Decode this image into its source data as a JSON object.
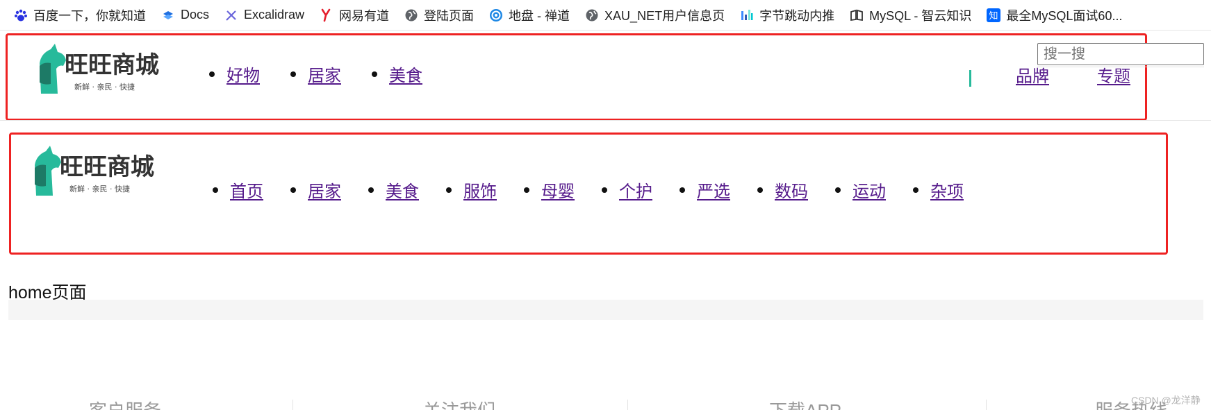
{
  "bookmarks": [
    {
      "label": "百度一下，你就知道",
      "icon": "baidu-paw-icon"
    },
    {
      "label": "Docs",
      "icon": "docs-icon"
    },
    {
      "label": "Excalidraw",
      "icon": "excalidraw-icon"
    },
    {
      "label": "网易有道",
      "icon": "youdao-icon"
    },
    {
      "label": "登陆页面",
      "icon": "globe-icon"
    },
    {
      "label": "地盘 - 禅道",
      "icon": "zentao-icon"
    },
    {
      "label": "XAU_NET用户信息页",
      "icon": "globe-icon"
    },
    {
      "label": "字节跳动内推",
      "icon": "bytedance-icon"
    },
    {
      "label": "MySQL - 智云知识",
      "icon": "book-icon"
    },
    {
      "label": "最全MySQL面试60...",
      "icon": "zhihu-icon"
    }
  ],
  "logo": {
    "title": "旺旺商城",
    "slogan": "新鲜 · 亲民 · 快捷"
  },
  "header1": {
    "nav": [
      "好物",
      "居家",
      "美食"
    ],
    "right_links": [
      "品牌",
      "专题"
    ]
  },
  "header2": {
    "nav": [
      "首页",
      "居家",
      "美食",
      "服饰",
      "母婴",
      "个护",
      "严选",
      "数码",
      "运动",
      "杂项"
    ],
    "search_placeholder": "搜一搜"
  },
  "page": {
    "title": "home页面"
  },
  "footer": {
    "items": [
      "客户服务",
      "关注我们",
      "下载APP",
      "服务热线"
    ]
  },
  "watermark": "CSDN @龙洋静",
  "colors": {
    "brand": "#27ba9b",
    "brand_dark": "#1d7a66",
    "highlight_border": "#ee2222",
    "link": "#551a8b"
  }
}
